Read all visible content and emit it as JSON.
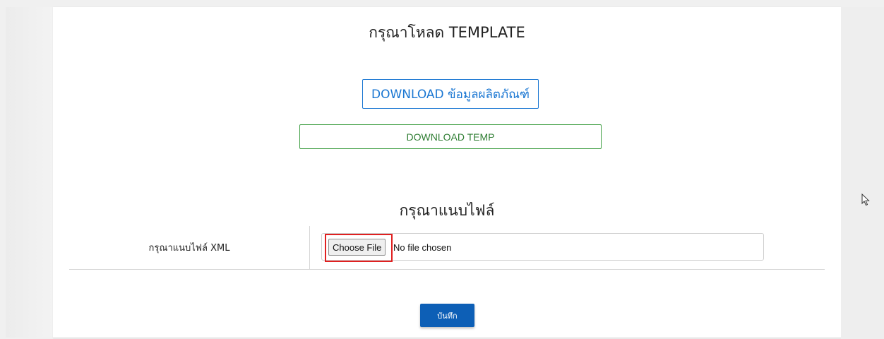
{
  "header": {
    "title": "กรุณาโหลด TEMPLATE"
  },
  "downloads": {
    "product_button_label": "DOWNLOAD ข้อมูลผลิตภัณฑ์",
    "temp_button_label": "DOWNLOAD TEMP"
  },
  "upload": {
    "section_title": "กรุณาแนบไฟล์",
    "field_label": "กรุณาแนบไฟล์ XML",
    "choose_file_label": "Choose File",
    "no_file_text": "No file chosen"
  },
  "actions": {
    "save_label": "บันทึก"
  },
  "colors": {
    "primary_blue": "#1976d2",
    "download_green": "#43a047",
    "save_button": "#0d5fb6",
    "highlight_red": "#e02020"
  },
  "icons": {
    "cursor": "mouse-pointer-icon"
  }
}
